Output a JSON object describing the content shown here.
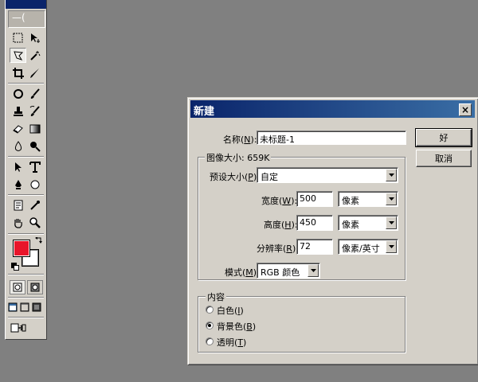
{
  "toolbox": {
    "logo_text": "—(",
    "foreground_color": "#e8152a",
    "background_color": "#ffffff",
    "tools": [
      "marquee-icon",
      "move-icon",
      "lasso-icon",
      "magic-wand-icon",
      "crop-icon",
      "slice-icon",
      "healing-brush-icon",
      "brush-icon",
      "clone-stamp-icon",
      "history-brush-icon",
      "eraser-icon",
      "gradient-icon",
      "blur-icon",
      "dodge-icon",
      "path-selection-icon",
      "type-icon",
      "pen-icon",
      "shape-icon",
      "notes-icon",
      "eyedropper-icon",
      "hand-icon",
      "zoom-icon"
    ]
  },
  "dialog": {
    "title": "新建",
    "close_glyph": "×",
    "name_label": "名称(",
    "name_key": "N",
    "name_label_end": "):",
    "name_value": "未标题-1",
    "image_size_label": "图像大小: 659K",
    "preset_label": "预设大小(",
    "preset_key": "P",
    "preset_label_end": "):",
    "preset_value": "自定",
    "width_label": "宽度(",
    "width_key": "W",
    "width_label_end": "):",
    "width_value": "500",
    "width_unit": "像素",
    "height_label": "高度(",
    "height_key": "H",
    "height_label_end": "):",
    "height_value": "450",
    "height_unit": "像素",
    "resolution_label": "分辨率(",
    "resolution_key": "R",
    "resolution_label_end": "):",
    "resolution_value": "72",
    "resolution_unit": "像素/英寸",
    "mode_label": "模式(",
    "mode_key": "M",
    "mode_label_end": "):",
    "mode_value": "RGB 颜色",
    "contents_label": "内容",
    "contents_options": [
      {
        "label": "白色(",
        "key": "I",
        "end": ")",
        "selected": false
      },
      {
        "label": "背景色(",
        "key": "B",
        "end": ")",
        "selected": true
      },
      {
        "label": "透明(",
        "key": "T",
        "end": ")",
        "selected": false
      }
    ],
    "ok_label": "好",
    "cancel_label": "取消"
  }
}
